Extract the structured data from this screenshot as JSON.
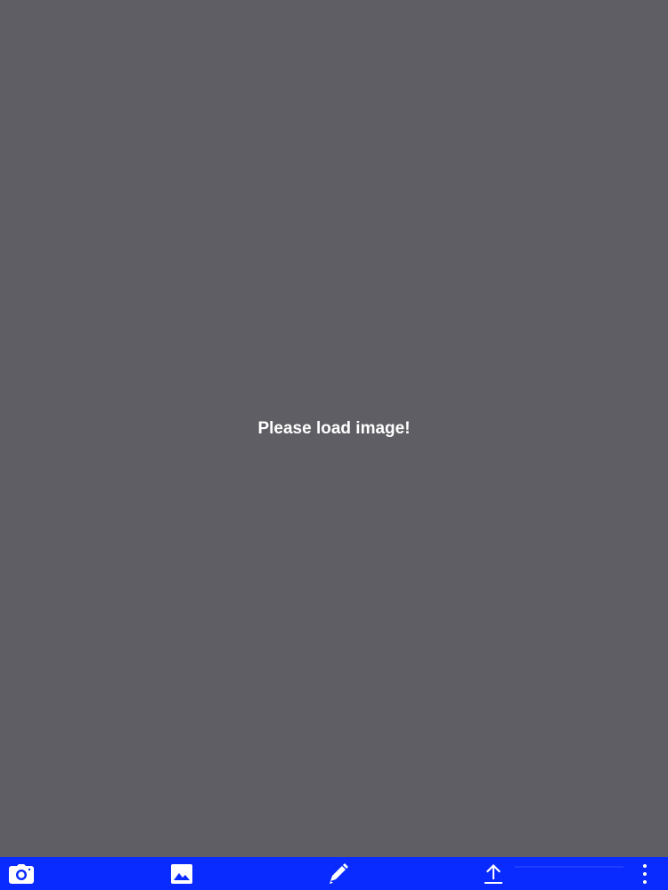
{
  "canvas": {
    "message": "Please load image!"
  },
  "toolbar": {
    "items": [
      {
        "name": "camera",
        "icon": "camera-icon"
      },
      {
        "name": "gallery",
        "icon": "image-icon"
      },
      {
        "name": "edit",
        "icon": "pencil-icon"
      },
      {
        "name": "upload",
        "icon": "upload-icon"
      },
      {
        "name": "more",
        "icon": "more-vertical-icon"
      }
    ]
  },
  "colors": {
    "background": "#5f5e64",
    "toolbar": "#0a2bff",
    "text": "#ffffff"
  }
}
